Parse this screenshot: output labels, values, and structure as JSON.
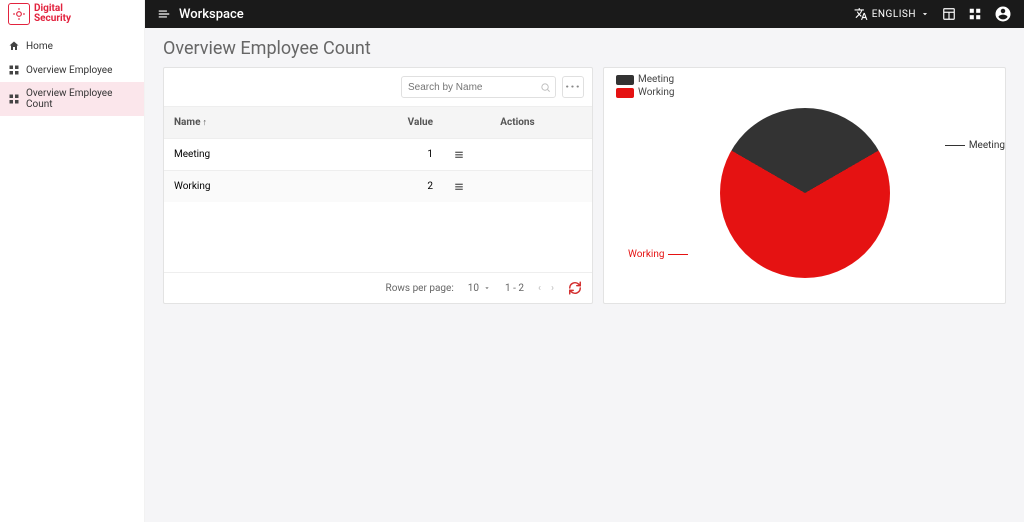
{
  "header": {
    "workspace_label": "Workspace",
    "language_label": "ENGLISH"
  },
  "brand": {
    "name_line1": "Digital",
    "name_line2": "Security"
  },
  "sidebar": {
    "items": [
      {
        "label": "Home",
        "icon": "home"
      },
      {
        "label": "Overview Employee",
        "icon": "grid"
      },
      {
        "label": "Overview Employee Count",
        "icon": "grid",
        "active": true
      }
    ]
  },
  "page": {
    "title": "Overview Employee Count"
  },
  "table": {
    "search_placeholder": "Search by Name",
    "columns": {
      "name": "Name",
      "value": "Value",
      "actions": "Actions"
    },
    "rows": [
      {
        "name": "Meeting",
        "value": 1
      },
      {
        "name": "Working",
        "value": 2
      }
    ],
    "pagination": {
      "rows_label": "Rows per page:",
      "rows_per_page": 10,
      "range": "1 - 2"
    }
  },
  "chart_data": {
    "type": "pie",
    "title": "",
    "legend_position": "top-left",
    "series": [
      {
        "name": "Meeting",
        "value": 1,
        "color": "#333333"
      },
      {
        "name": "Working",
        "value": 2,
        "color": "#e51212"
      }
    ]
  },
  "chart_labels": {
    "meeting": "Meeting",
    "working": "Working"
  }
}
